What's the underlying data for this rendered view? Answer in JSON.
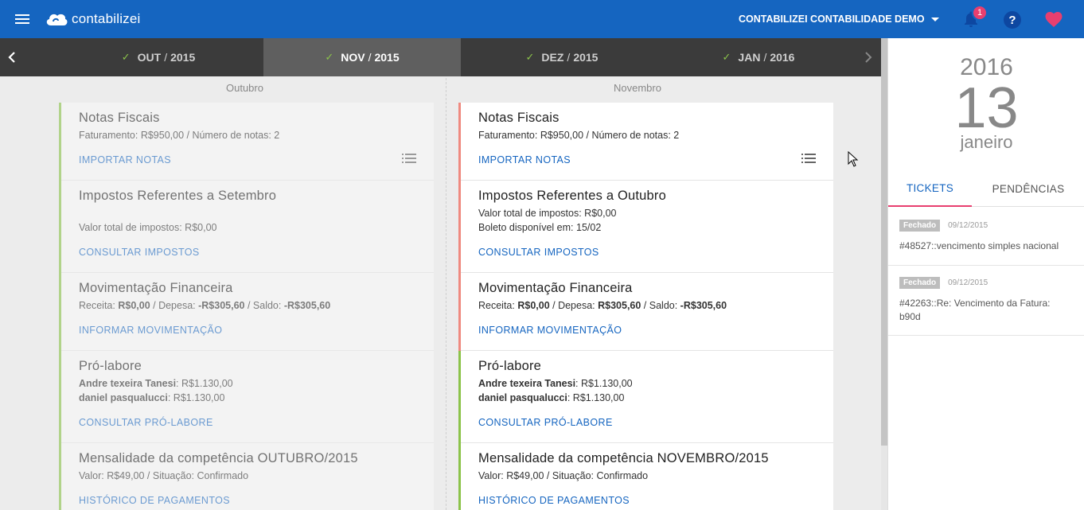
{
  "app": {
    "logo_text": "contabilizei",
    "company_name": "CONTABILIZEI CONTABILIDADE DEMO",
    "notification_count": "1",
    "help_symbol": "?",
    "colors": {
      "primary": "#1565c0",
      "accent": "#e83f6f",
      "ok": "#8bc34a",
      "pending": "#ef8a80"
    }
  },
  "months": [
    {
      "label": "OUT",
      "year": "2015",
      "status": "check"
    },
    {
      "label": "NOV",
      "year": "2015",
      "status": "check",
      "active": true
    },
    {
      "label": "DEZ",
      "year": "2015",
      "status": "check"
    },
    {
      "label": "JAN",
      "year": "2016",
      "status": "check"
    }
  ],
  "month_sep": "/",
  "columns": [
    {
      "title": "Outubro",
      "invoices": {
        "title": "Notas Fiscais",
        "line": "Faturamento: R$950,00 / Número de notas: 2",
        "action": "IMPORTAR NOTAS"
      },
      "taxes": {
        "title": "Impostos Referentes a Setembro",
        "line1": "",
        "line2": "Valor total de impostos: R$0,00",
        "action": "CONSULTAR IMPOSTOS"
      },
      "finance": {
        "title": "Movimentação Financeira",
        "pre1": "Receita: ",
        "v1": "R$0,00",
        "pre2": " / Depesa: ",
        "v2": "-R$305,60",
        "pre3": " / Saldo: ",
        "v3": "-R$305,60",
        "action": "INFORMAR MOVIMENTAÇÃO"
      },
      "prolabore": {
        "title": "Pró-labore",
        "name1": "Andre texeira Tanesi",
        "val1": ": R$1.130,00",
        "name2": "daniel pasqualucci",
        "val2": ": R$1.130,00",
        "action": "CONSULTAR PRÓ-LABORE"
      },
      "fee": {
        "title": "Mensalidade da competência OUTUBRO/2015",
        "line": "Valor: R$49,00 / Situação: Confirmado",
        "action": "HISTÓRICO DE PAGAMENTOS"
      }
    },
    {
      "title": "Novembro",
      "invoices": {
        "title": "Notas Fiscais",
        "line": "Faturamento: R$950,00 / Número de notas: 2",
        "action": "IMPORTAR NOTAS"
      },
      "taxes": {
        "title": "Impostos Referentes a Outubro",
        "line1": "Valor total de impostos: R$0,00",
        "line2": "Boleto disponível em: 15/02",
        "action": "CONSULTAR IMPOSTOS"
      },
      "finance": {
        "title": "Movimentação Financeira",
        "pre1": "Receita: ",
        "v1": "R$0,00",
        "pre2": " / Depesa: ",
        "v2": "R$305,60",
        "pre3": " / Saldo: ",
        "v3": "-R$305,60",
        "action": "INFORMAR MOVIMENTAÇÃO"
      },
      "prolabore": {
        "title": "Pró-labore",
        "name1": "Andre texeira Tanesi",
        "val1": ": R$1.130,00",
        "name2": "daniel pasqualucci",
        "val2": ": R$1.130,00",
        "action": "CONSULTAR PRÓ-LABORE"
      },
      "fee": {
        "title": "Mensalidade da competência NOVEMBRO/2015",
        "line": "Valor: R$49,00 / Situação: Confirmado",
        "action": "HISTÓRICO DE PAGAMENTOS"
      }
    }
  ],
  "calendar": {
    "year": "2016",
    "day": "13",
    "month": "janeiro"
  },
  "right_tabs": {
    "tickets": "TICKETS",
    "pendencias": "PENDÊNCIAS"
  },
  "tickets": [
    {
      "status": "Fechado",
      "date": "09/12/2015",
      "subject": "#48527::vencimento simples nacional"
    },
    {
      "status": "Fechado",
      "date": "09/12/2015",
      "subject": "#42263::Re: Vencimento da Fatura: b90d"
    }
  ],
  "icons": [
    "menu-icon",
    "cloud-logo-icon",
    "caret-down-icon",
    "bell-icon",
    "help-icon",
    "heart-icon",
    "chevron-left-icon",
    "chevron-right-icon",
    "check-icon",
    "list-icon",
    "mouse-cursor-icon"
  ]
}
